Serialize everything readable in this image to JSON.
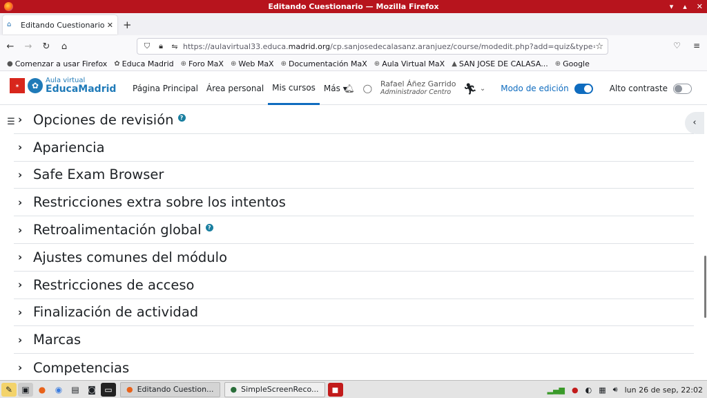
{
  "window": {
    "title": "Editando Cuestionario — Mozilla Firefox",
    "controls": [
      "▾",
      "▴",
      "✕"
    ]
  },
  "browser": {
    "tab_title": "Editando Cuestionario",
    "tab_close": "✕",
    "new_tab": "+",
    "url_base": "https://aulavirtual33.educa.",
    "url_domain": "madrid.org",
    "url_path": "/cp.sanjosedecalasanz.aranjuez/course/modedit.php?add=quiz&type=&cou",
    "bookmarks": [
      "Comenzar a usar Firefox",
      "Educa Madrid",
      "Foro MaX",
      "Web MaX",
      "Documentación MaX",
      "Aula Virtual MaX",
      "SAN JOSE DE CALASA...",
      "Google"
    ]
  },
  "site": {
    "logo_small": "Aula virtual",
    "logo_big": "EducaMadrid",
    "nav": [
      "Página Principal",
      "Área personal",
      "Mis cursos",
      "Más ▾"
    ],
    "active_nav": 2,
    "user_name": "Rafael Áñez Garrido",
    "user_role": "Administrador Centro",
    "edit_mode_label": "Modo de edición",
    "edit_mode_on": true,
    "contrast_label": "Alto contraste",
    "contrast_on": false
  },
  "sections": [
    {
      "label": "Opciones de revisión",
      "help": true
    },
    {
      "label": "Apariencia",
      "help": false
    },
    {
      "label": "Safe Exam Browser",
      "help": false
    },
    {
      "label": "Restricciones extra sobre los intentos",
      "help": false
    },
    {
      "label": "Retroalimentación global",
      "help": true
    },
    {
      "label": "Ajustes comunes del módulo",
      "help": false
    },
    {
      "label": "Restricciones de acceso",
      "help": false
    },
    {
      "label": "Finalización de actividad",
      "help": false
    },
    {
      "label": "Marcas",
      "help": false
    },
    {
      "label": "Competencias",
      "help": false
    }
  ],
  "taskbar": {
    "tasks": [
      "Editando Cuestion...",
      "SimpleScreenReco..."
    ],
    "clock": "lun 26 de sep, 22:02"
  }
}
